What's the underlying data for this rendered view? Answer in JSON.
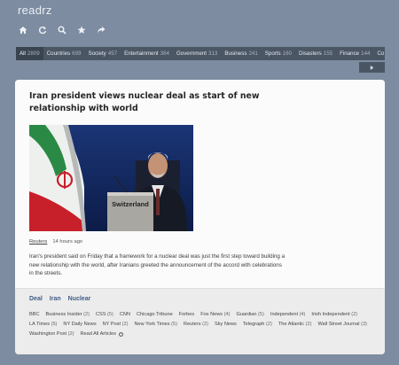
{
  "app": {
    "brand": "readrz"
  },
  "toolbar": {
    "icons": [
      "home-icon",
      "refresh-icon",
      "search-icon",
      "star-icon",
      "share-icon"
    ]
  },
  "categories": [
    {
      "label": "All",
      "count": "2809",
      "active": true
    },
    {
      "label": "Countries",
      "count": "699"
    },
    {
      "label": "Society",
      "count": "457"
    },
    {
      "label": "Entertainment",
      "count": "364"
    },
    {
      "label": "Government",
      "count": "313"
    },
    {
      "label": "Business",
      "count": "241"
    },
    {
      "label": "Sports",
      "count": "160"
    },
    {
      "label": "Disasters",
      "count": "155"
    },
    {
      "label": "Finance",
      "count": "144"
    },
    {
      "label": "Co",
      "count": ""
    }
  ],
  "article": {
    "title": "Iran president views nuclear deal as start of new relationship with world",
    "image_text": "Switzerland",
    "source": "Reuters",
    "time": "14 hours ago",
    "summary": "Iran's president said on Friday that a framework for a nuclear deal was just the first step toward building a new relationship with the world, after Iranians greeted the announcement of the accord with celebrations in the streets.",
    "tags": [
      "Deal",
      "Iran",
      "Nuclear"
    ],
    "sources": [
      {
        "name": "BBC",
        "count": ""
      },
      {
        "name": "Business Insider",
        "count": "(2)"
      },
      {
        "name": "CSS",
        "count": "(5)"
      },
      {
        "name": "CNN",
        "count": ""
      },
      {
        "name": "Chicago Tribune",
        "count": ""
      },
      {
        "name": "Forbes",
        "count": ""
      },
      {
        "name": "Fox News",
        "count": "(4)"
      },
      {
        "name": "Guardian",
        "count": "(5)"
      },
      {
        "name": "Independent",
        "count": "(4)"
      },
      {
        "name": "Irish Independent",
        "count": "(2)"
      },
      {
        "name": "LA Times",
        "count": "(5)"
      },
      {
        "name": "NY Daily News",
        "count": ""
      },
      {
        "name": "NY Post",
        "count": "(2)"
      },
      {
        "name": "New York Times",
        "count": "(5)"
      },
      {
        "name": "Reuters",
        "count": "(2)"
      },
      {
        "name": "Sky News",
        "count": ""
      },
      {
        "name": "Telegraph",
        "count": "(2)"
      },
      {
        "name": "The Atlantic",
        "count": "(2)"
      },
      {
        "name": "Wall Street Journal",
        "count": "(3)"
      },
      {
        "name": "Washington Post",
        "count": "(2)"
      }
    ],
    "read_all": "Read All Articles"
  },
  "colors": {
    "background": "#7d8ca0",
    "category_bar": "#4b5665",
    "tag_link": "#3f5c85"
  }
}
